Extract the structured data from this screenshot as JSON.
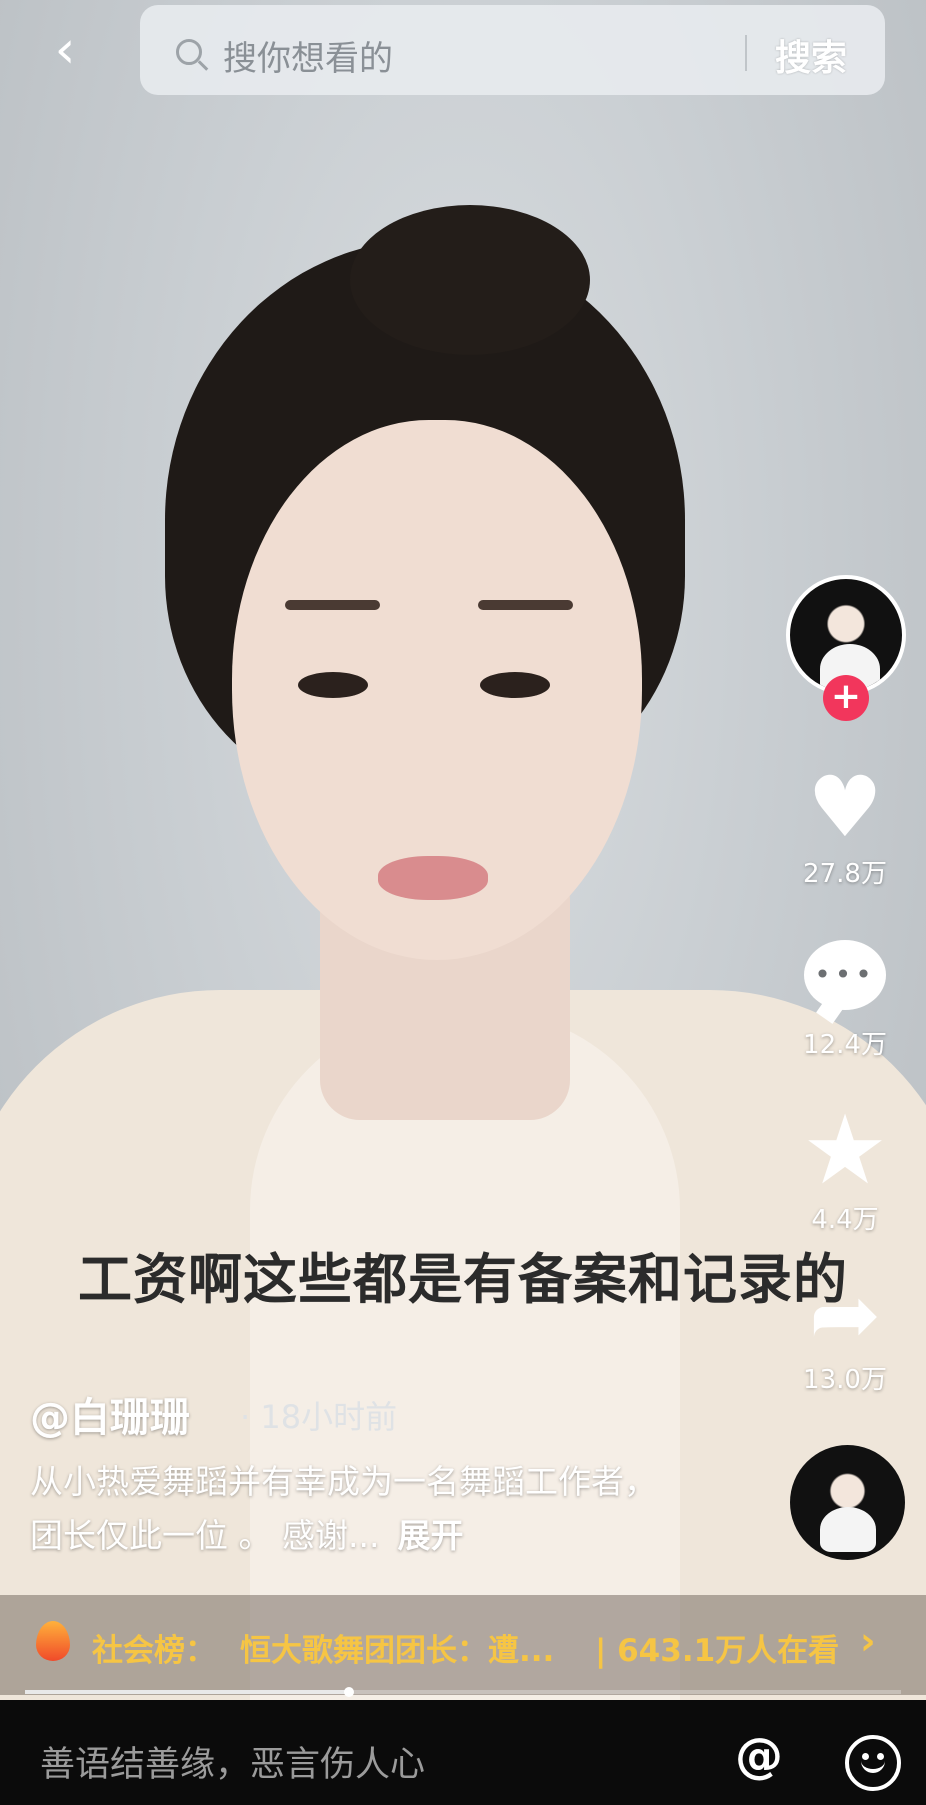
{
  "search": {
    "placeholder": "搜你想看的",
    "button_label": "搜索"
  },
  "actions": {
    "likes": "27.8万",
    "comments": "12.4万",
    "favorites": "4.4万",
    "shares": "13.0万"
  },
  "video": {
    "subtitle": "工资啊这些都是有备案和记录的",
    "author": "@白珊珊",
    "time": "· 18小时前",
    "description": "从小热爱舞蹈并有幸成为一名舞蹈工作者，团长仅此一位 。 感谢...",
    "expand_label": "展开",
    "progress": 0.37
  },
  "hot": {
    "label": "社会榜：",
    "title": "恒大歌舞团团长：遭...",
    "views": "| 643.1万人在看",
    "arrow": "›"
  },
  "comment": {
    "placeholder": "善语结善缘，恶言伤人心"
  },
  "icons": {
    "back": "‹",
    "follow": "+",
    "heart": "♥",
    "comment": "•••",
    "star": "★",
    "share": "➦",
    "at": "@"
  },
  "colors": {
    "follow_red": "#f2365c",
    "hot_yellow": "#f6c544"
  }
}
